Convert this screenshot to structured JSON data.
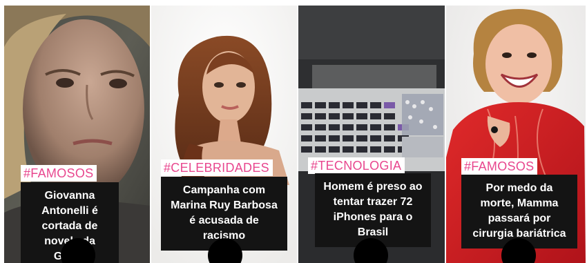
{
  "colors": {
    "hashtag_pink": "#e8468e",
    "caption_bg": "#141414",
    "caption_text": "#ffffff"
  },
  "stories": [
    {
      "hashtag": "#FAMOSOS",
      "title": "Giovanna Antonelli é cortada de novela da Globo",
      "image": "woman-closeup-portrait"
    },
    {
      "hashtag": "#CELEBRIDADES",
      "title": "Campanha com Marina Ruy Barbosa é acusada de racismo",
      "image": "woman-studio-portrait"
    },
    {
      "hashtag": "#TECNOLOGIA",
      "title": "Homem é preso ao tentar trazer 72 iPhones para o Brasil",
      "image": "seized-phones-on-table"
    },
    {
      "hashtag": "#FAMOSOS",
      "title": "Por medo da morte, Mamma passará por cirurgia bariátrica",
      "image": "smiling-woman-red-dress"
    }
  ]
}
